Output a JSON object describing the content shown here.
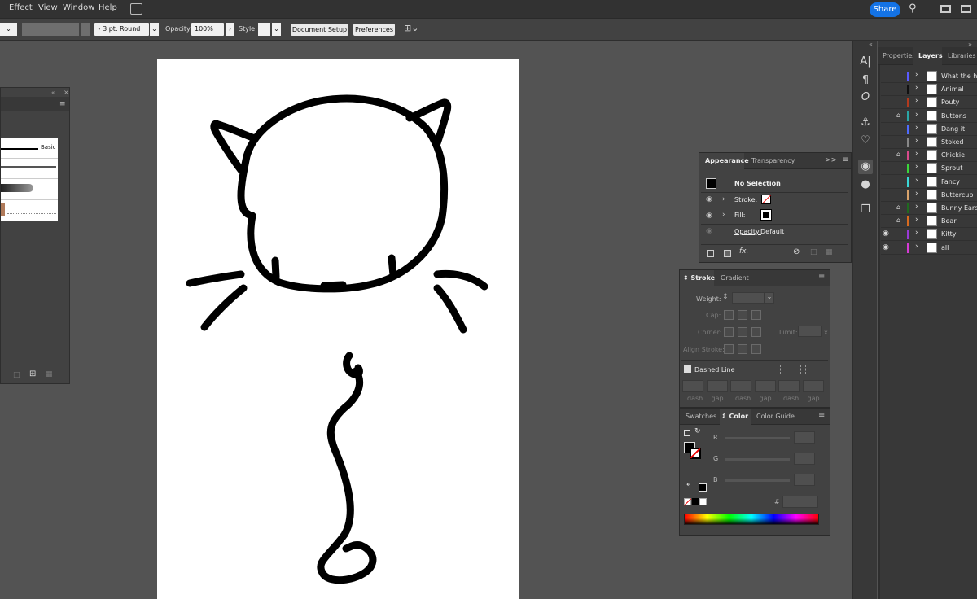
{
  "menubar": {
    "items": [
      "Effect",
      "View",
      "Window",
      "Help"
    ],
    "share_label": "Share"
  },
  "controlbar": {
    "brush_value": "3 pt. Round",
    "opacity_label": "Opacity:",
    "opacity_value": "100%",
    "style_label": "Style:",
    "document_setup": "Document Setup",
    "preferences": "Preferences"
  },
  "brushes": {
    "basic_label": "Basic"
  },
  "layers_panel": {
    "tabs": [
      "Properties",
      "Layers",
      "Libraries"
    ],
    "active_tab": "Layers",
    "layers": [
      {
        "name": "What the heck",
        "color": "#5a5aff",
        "visible": false,
        "locked": false
      },
      {
        "name": "Animal",
        "color": "#111111",
        "visible": false,
        "locked": false
      },
      {
        "name": "Pouty",
        "color": "#b33a1e",
        "visible": false,
        "locked": false
      },
      {
        "name": "Buttons",
        "color": "#2aa6a6",
        "visible": false,
        "locked": true
      },
      {
        "name": "Dang it",
        "color": "#4f6bff",
        "visible": false,
        "locked": false
      },
      {
        "name": "Stoked",
        "color": "#888888",
        "visible": false,
        "locked": false
      },
      {
        "name": "Chickie",
        "color": "#d94a8c",
        "visible": false,
        "locked": true
      },
      {
        "name": "Sprout",
        "color": "#3ad63a",
        "visible": false,
        "locked": false
      },
      {
        "name": "Fancy",
        "color": "#3ad6d6",
        "visible": false,
        "locked": false
      },
      {
        "name": "Buttercup",
        "color": "#d9a36b",
        "visible": false,
        "locked": false
      },
      {
        "name": "Bunny Ears",
        "color": "#1f6b1f",
        "visible": false,
        "locked": true
      },
      {
        "name": "Bear",
        "color": "#d96b1e",
        "visible": false,
        "locked": true
      },
      {
        "name": "Kitty",
        "color": "#9a3ad6",
        "visible": true,
        "locked": false
      },
      {
        "name": "all",
        "color": "#d63ad6",
        "visible": true,
        "locked": false
      }
    ]
  },
  "appearance_panel": {
    "tabs": [
      "Appearance",
      "Transparency"
    ],
    "selection": "No Selection",
    "stroke_label": "Stroke:",
    "fill_label": "Fill:",
    "opacity_label": "Opacity:",
    "opacity_value": "Default"
  },
  "stroke_panel": {
    "tabs": [
      "Stroke",
      "Gradient"
    ],
    "weight_label": "Weight:",
    "cap_label": "Cap:",
    "corner_label": "Corner:",
    "limit_label": "Limit:",
    "limit_unit": "x",
    "align_label": "Align Stroke:",
    "dashed_label": "Dashed Line",
    "dash_labels": [
      "dash",
      "gap",
      "dash",
      "gap",
      "dash",
      "gap"
    ]
  },
  "color_panel": {
    "tabs": [
      "Swatches",
      "Color",
      "Color Guide"
    ],
    "channels": [
      "R",
      "G",
      "B"
    ],
    "hex_label": "#"
  }
}
